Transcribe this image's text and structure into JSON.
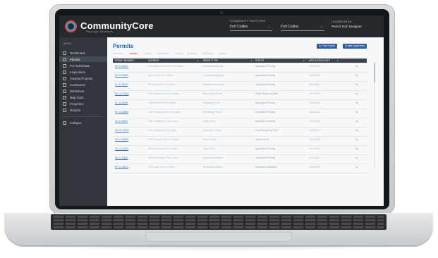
{
  "app": {
    "brand": "CommunityCore",
    "brand_sub": "Package Solutions",
    "colors": {
      "header_bg": "#262a2f",
      "sidebar_bg": "#31363c",
      "accent_blue": "#2d5f9e",
      "brand_red": "#e14b3b"
    }
  },
  "header": {
    "context_label": "COMMUNITY SWITCHER",
    "context_value": "Fort Collins",
    "context2_value": "Fort Collins",
    "user_label": "LOGGED IN AS",
    "user_name": "Permit Tech Designer"
  },
  "sidebar": {
    "menu_label": "MENU",
    "items": [
      {
        "label": "Dashboard",
        "icon": "dashboard-icon"
      },
      {
        "label": "Permits",
        "icon": "permit-icon",
        "active": true
      },
      {
        "label": "Pre-Submittals",
        "icon": "clipboard-icon"
      },
      {
        "label": "Inspections",
        "icon": "inspection-icon"
      },
      {
        "label": "Tracked Projects",
        "icon": "folder-icon"
      },
      {
        "label": "Contractors",
        "icon": "hardhat-icon"
      },
      {
        "label": "Worksheet",
        "icon": "sheet-icon"
      },
      {
        "label": "Map Tools",
        "icon": "map-icon"
      },
      {
        "label": "Properties",
        "icon": "home-icon"
      },
      {
        "label": "Reports",
        "icon": "report-icon"
      }
    ],
    "collapse_label": "Collapse"
  },
  "main": {
    "title": "Permits",
    "buttons": {
      "find": "Q, Find Permit",
      "create": "Create Application"
    },
    "tabs": [
      "All Items",
      "Active",
      "Issued",
      "Inspection",
      "Closed",
      "Expired",
      "Withdrawn",
      "Archive"
    ],
    "table": {
      "columns": [
        "PERMIT NUMBER",
        "ADDRESS",
        "PERMIT TYPE",
        "STATUS",
        "APPLICATION DATE"
      ],
      "rows": [
        [
          "BP-21-00001",
          "1234 Main St Unit 104, Fort Collins",
          "Residential Building",
          "Application Pending",
          "01/04/2021"
        ],
        [
          "BP-21-00002",
          "5678 Elm St, Fort Collins",
          "Commercial Building",
          "Application Pending",
          "01/05/2021"
        ],
        [
          "EL-21-00003",
          "910 Walnut St, Fort Collins",
          "Residential Electrical",
          "Application Pending",
          "01/06/2021"
        ],
        [
          "MC-21-00004",
          "1122 Harmony Rd, Fort Collins",
          "Mechanical Permit",
          "Under Review by Staff",
          "01/07/2021"
        ],
        [
          "PL-21-00005",
          "4455 Drake Rd, Fort Collins",
          "Plumbing Permit",
          "Application Pending",
          "01/08/2021"
        ],
        [
          "RF-21-00006",
          "7788 Timberline Rd, Fort Collins",
          "Re-Roofing Permit",
          "Application Pending",
          "01/09/2021"
        ],
        [
          "SL-21-00007",
          "3300 College Ave, Fort Collins",
          "Solar Permit",
          "Application Pending",
          "01/10/2021"
        ],
        [
          "DM-21-00008",
          "2500 Shields St, Fort Collins",
          "Demolition Permit",
          "Under Review by Staff",
          "01/11/2021"
        ],
        [
          "FN-21-00009",
          "6120 Prospect Rd, Fort Collins",
          "Fence Permit",
          "Issued Permit",
          "01/12/2021"
        ],
        [
          "SG-21-00010",
          "8015 Lemay Ave, Fort Collins",
          "Sign Permit",
          "Application Pending",
          "01/13/2021"
        ],
        [
          "BP-21-00011",
          "9001 Mulberry St, Fort Collins",
          "Accessory Structure",
          "Application Pending",
          "01/14/2021"
        ],
        [
          "BP-21-00012",
          "1200 Laurel St, Fort Collins",
          "Residential Addition",
          "Inspection Scheduled",
          "01/15/2021"
        ]
      ]
    }
  }
}
